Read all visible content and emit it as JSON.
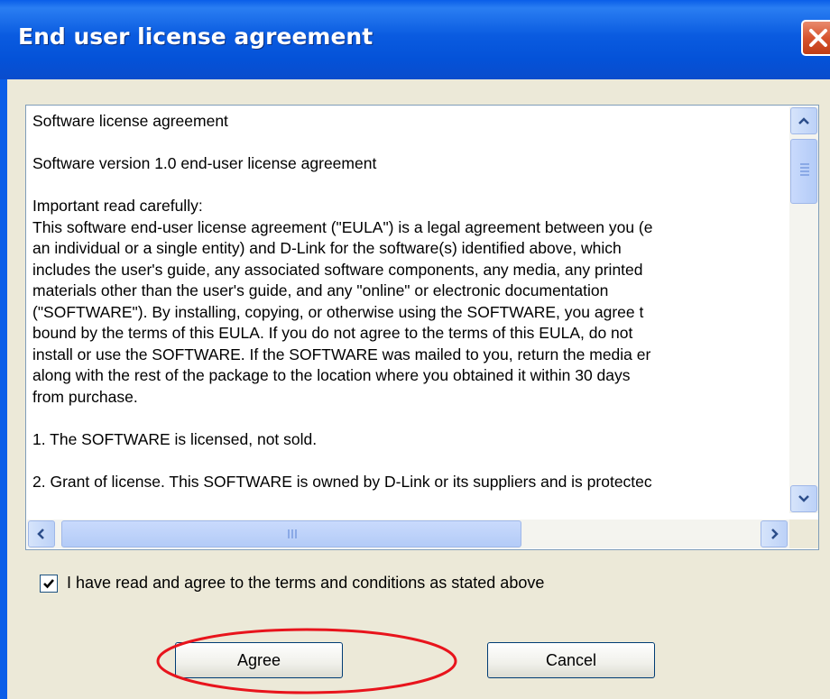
{
  "window": {
    "title": "End user license agreement",
    "close_icon": "close-icon"
  },
  "eula": {
    "lines": [
      "Software license agreement",
      "",
      "Software version 1.0 end-user license agreement",
      "",
      "Important read carefully:",
      "This software end-user license agreement (\"EULA\") is a legal agreement between you (e",
      "an individual or a single entity) and D-Link for the software(s) identified above, which",
      "includes the user's guide, any associated software components, any media, any printed",
      "materials other than the user's guide, and any \"online\" or electronic documentation",
      "(\"SOFTWARE\"). By installing, copying, or otherwise using the SOFTWARE, you agree t",
      "bound by the terms of this EULA. If you do not agree to the terms of this EULA, do not",
      "install or use the SOFTWARE. If the SOFTWARE was mailed to you, return the media er",
      "along with the rest of the package to the location where you obtained it within 30 days",
      "from purchase.",
      "",
      "1. The SOFTWARE is licensed, not sold.",
      "",
      "2. Grant of license. This SOFTWARE is owned by D-Link or its suppliers and is protectec"
    ]
  },
  "agreement": {
    "checked": true,
    "label": "I have read and agree to the terms and conditions as stated above"
  },
  "buttons": {
    "agree_label": "Agree",
    "cancel_label": "Cancel"
  },
  "annotation": {
    "highlight_color": "#e8141c",
    "highlighted": "Agree"
  },
  "colors": {
    "titlebar": "#0a5ee8",
    "dialog_bg": "#ece9d8",
    "button_border": "#003c74"
  }
}
